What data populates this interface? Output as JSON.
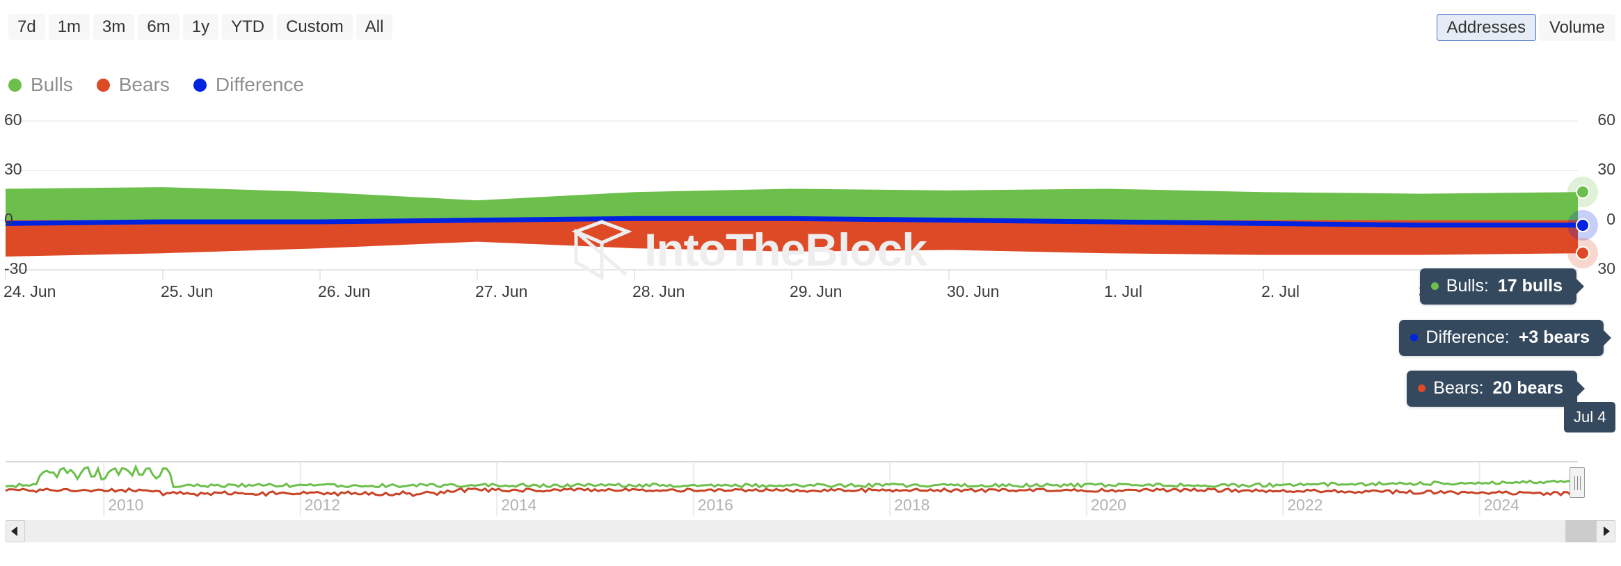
{
  "range_selector": {
    "buttons": [
      {
        "label": "7d"
      },
      {
        "label": "1m"
      },
      {
        "label": "3m"
      },
      {
        "label": "6m"
      },
      {
        "label": "1y"
      },
      {
        "label": "YTD"
      },
      {
        "label": "Custom"
      },
      {
        "label": "All"
      }
    ]
  },
  "metric_selector": {
    "buttons": [
      {
        "label": "Addresses",
        "selected": true
      },
      {
        "label": "Volume",
        "selected": false
      }
    ],
    "selected_border_color": "#4774c4",
    "selected_bg_color": "#e6ecf5"
  },
  "legend": {
    "items": [
      {
        "label": "Bulls",
        "color": "#6cbf4b"
      },
      {
        "label": "Bears",
        "color": "#de4a26"
      },
      {
        "label": "Difference",
        "color": "#0023e0"
      }
    ]
  },
  "watermark": {
    "text": "IntoTheBlock",
    "color": "#eeeeee"
  },
  "tooltips": [
    {
      "name": "Bulls:",
      "value": "17 bulls",
      "dot_color": "#6cbf4b"
    },
    {
      "name": "Difference:",
      "value": "+3 bears",
      "dot_color": "#0023e0"
    },
    {
      "name": "Bears:",
      "value": "20 bears",
      "dot_color": "#de4a26"
    }
  ],
  "date_flag": {
    "label": "Jul 4"
  },
  "navigator": {
    "year_labels": [
      "2010",
      "2012",
      "2014",
      "2016",
      "2018",
      "2020",
      "2022",
      "2024"
    ],
    "handle_position": "right"
  },
  "chart_data": {
    "type": "area",
    "title": "",
    "subtitle": "",
    "xlabel": "",
    "ylabel": "",
    "ylim": [
      -30,
      60
    ],
    "y_ticks": [
      -30,
      0,
      30,
      60
    ],
    "y_tick_labels_left": [
      "-30",
      "0",
      "30",
      "60"
    ],
    "y_tick_labels_right": [
      "30",
      "0",
      "30",
      "60"
    ],
    "grid": true,
    "legend_position": "top-left",
    "x_tick_labels": [
      "24. Jun",
      "25. Jun",
      "26. Jun",
      "27. Jun",
      "28. Jun",
      "29. Jun",
      "30. Jun",
      "1. Jul",
      "2. Jul",
      "3. Jul"
    ],
    "x": [
      "24. Jun",
      "25. Jun",
      "26. Jun",
      "27. Jun",
      "28. Jun",
      "29. Jun",
      "30. Jun",
      "1. Jul",
      "2. Jul",
      "3. Jul",
      "Jul 4"
    ],
    "series": [
      {
        "name": "Bulls",
        "color": "#6cbf4b",
        "values": [
          19,
          20,
          17,
          12,
          17,
          19,
          18,
          19,
          17,
          16,
          17
        ]
      },
      {
        "name": "Bears",
        "color": "#de4a26",
        "values": [
          -22,
          -20,
          -17,
          -13,
          -17,
          -19,
          -18,
          -20,
          -21,
          -21,
          -20
        ]
      },
      {
        "name": "Difference",
        "color": "#0023e0",
        "values": [
          -2,
          -1,
          -1,
          0,
          1,
          1,
          0,
          -1,
          -2,
          -3,
          -3
        ]
      }
    ],
    "navigator_series": [
      {
        "name": "Bulls",
        "color": "#6cbf4b"
      },
      {
        "name": "Bears",
        "color": "#de4a26"
      }
    ],
    "navigator_range_years": [
      "2009",
      "2024"
    ]
  }
}
